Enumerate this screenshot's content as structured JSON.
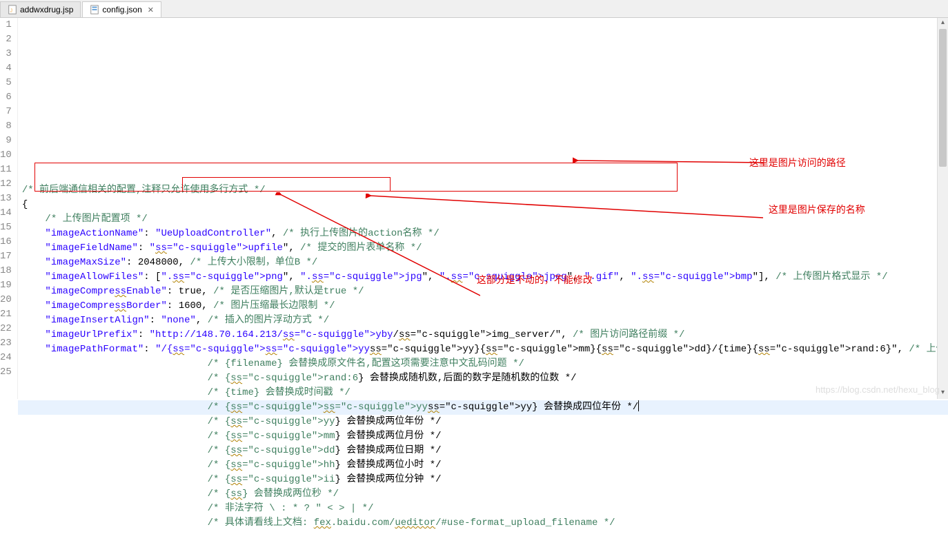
{
  "tabs": [
    {
      "label": "addwxdrug.jsp",
      "icon": "jsp-file-icon",
      "active": false
    },
    {
      "label": "config.json",
      "icon": "json-file-icon",
      "active": true
    }
  ],
  "annotations": {
    "url_prefix_note": "这里是图片访问的路径",
    "path_format_note": "这里是图片保存的名称",
    "fixed_part_note": "这部分是不动的，不能修改"
  },
  "watermark": "https://blog.csdn.net/hexu_blog",
  "code_lines": [
    {
      "n": 1,
      "tokens": [
        [
          "comment",
          "/* 前后端通信相关的配置,注释只允许使用多行方式 */"
        ]
      ]
    },
    {
      "n": 2,
      "tokens": [
        [
          "punc",
          "{"
        ]
      ]
    },
    {
      "n": 3,
      "indent": 2,
      "tokens": [
        [
          "comment",
          "/* 上传图片配置项 */"
        ]
      ]
    },
    {
      "n": 4,
      "indent": 2,
      "tokens": [
        [
          "key",
          "\"imageActionName\""
        ],
        [
          "punc",
          ": "
        ],
        [
          "str",
          "\"UeUploadController\""
        ],
        [
          "punc",
          ", "
        ],
        [
          "comment",
          "/* 执行上传图片的action名称 */"
        ]
      ]
    },
    {
      "n": 5,
      "indent": 2,
      "tokens": [
        [
          "key",
          "\"imageFieldName\""
        ],
        [
          "punc",
          ": "
        ],
        [
          "str",
          "\"upfile\""
        ],
        [
          "punc",
          ", "
        ],
        [
          "comment",
          "/* 提交的图片表单名称 */"
        ]
      ]
    },
    {
      "n": 6,
      "indent": 2,
      "tokens": [
        [
          "key",
          "\"imageMaxSize\""
        ],
        [
          "punc",
          ": "
        ],
        [
          "num",
          "2048000"
        ],
        [
          "punc",
          ", "
        ],
        [
          "comment",
          "/* 上传大小限制，单位B */"
        ]
      ]
    },
    {
      "n": 7,
      "indent": 2,
      "tokens": [
        [
          "key",
          "\"imageAllowFiles\""
        ],
        [
          "punc",
          ": ["
        ],
        [
          "str",
          "\".png\""
        ],
        [
          "punc",
          ", "
        ],
        [
          "str",
          "\".jpg\""
        ],
        [
          "punc",
          ", "
        ],
        [
          "str",
          "\".jpeg\""
        ],
        [
          "punc",
          ", "
        ],
        [
          "str",
          "\".gif\""
        ],
        [
          "punc",
          ", "
        ],
        [
          "str",
          "\".bmp\""
        ],
        [
          "punc",
          "], "
        ],
        [
          "comment",
          "/* 上传图片格式显示 */"
        ]
      ]
    },
    {
      "n": 8,
      "indent": 2,
      "tokens": [
        [
          "key",
          "\"imageCompressEnable\""
        ],
        [
          "punc",
          ": "
        ],
        [
          "num",
          "true"
        ],
        [
          "punc",
          ", "
        ],
        [
          "comment",
          "/* 是否压缩图片,默认是true */"
        ]
      ]
    },
    {
      "n": 9,
      "indent": 2,
      "tokens": [
        [
          "key",
          "\"imageCompressBorder\""
        ],
        [
          "punc",
          ": "
        ],
        [
          "num",
          "1600"
        ],
        [
          "punc",
          ", "
        ],
        [
          "comment",
          "/* 图片压缩最长边限制 */"
        ]
      ]
    },
    {
      "n": 10,
      "indent": 2,
      "tokens": [
        [
          "key",
          "\"imageInsertAlign\""
        ],
        [
          "punc",
          ": "
        ],
        [
          "str",
          "\"none\""
        ],
        [
          "punc",
          ", "
        ],
        [
          "comment",
          "/* 插入的图片浮动方式 */"
        ]
      ]
    },
    {
      "n": 11,
      "indent": 2,
      "tokens": [
        [
          "key",
          "\"imageUrlPrefix\""
        ],
        [
          "punc",
          ": "
        ],
        [
          "str",
          "\"http://148.70.164.213/yby/img_server/\""
        ],
        [
          "punc",
          ", "
        ],
        [
          "comment",
          "/* 图片访问路径前缀 */"
        ]
      ]
    },
    {
      "n": 12,
      "indent": 2,
      "tokens": [
        [
          "key",
          "\"imagePathFormat\""
        ],
        [
          "punc",
          ": "
        ],
        [
          "str",
          "\"/{yyyy}{mm}{dd}/{time}{rand:6}\""
        ],
        [
          "punc",
          ", "
        ],
        [
          "comment",
          "/* 上传保存路径,可以自定义保存路径和文件名格式 */"
        ]
      ]
    },
    {
      "n": 13,
      "indent": 16,
      "tokens": [
        [
          "comment",
          "/* {filename} 会替换成原文件名,配置这项需要注意中文乱码问题 */"
        ]
      ]
    },
    {
      "n": 14,
      "indent": 16,
      "tokens": [
        [
          "comment",
          "/* {rand:6} 会替换成随机数,后面的数字是随机数的位数 */"
        ]
      ]
    },
    {
      "n": 15,
      "indent": 16,
      "tokens": [
        [
          "comment",
          "/* {time} 会替换成时间戳 */"
        ]
      ]
    },
    {
      "n": 16,
      "indent": 16,
      "highlight": true,
      "cursor": true,
      "tokens": [
        [
          "comment",
          "/* {yyyy} 会替换成四位年份 */"
        ]
      ]
    },
    {
      "n": 17,
      "indent": 16,
      "tokens": [
        [
          "comment",
          "/* {yy} 会替换成两位年份 */"
        ]
      ]
    },
    {
      "n": 18,
      "indent": 16,
      "tokens": [
        [
          "comment",
          "/* {mm} 会替换成两位月份 */"
        ]
      ]
    },
    {
      "n": 19,
      "indent": 16,
      "tokens": [
        [
          "comment",
          "/* {dd} 会替换成两位日期 */"
        ]
      ]
    },
    {
      "n": 20,
      "indent": 16,
      "tokens": [
        [
          "comment",
          "/* {hh} 会替换成两位小时 */"
        ]
      ]
    },
    {
      "n": 21,
      "indent": 16,
      "tokens": [
        [
          "comment",
          "/* {ii} 会替换成两位分钟 */"
        ]
      ]
    },
    {
      "n": 22,
      "indent": 16,
      "tokens": [
        [
          "comment",
          "/* {ss} 会替换成两位秒 */"
        ]
      ]
    },
    {
      "n": 23,
      "indent": 16,
      "tokens": [
        [
          "comment",
          "/* 非法字符 \\ : * ? \" < > | */"
        ]
      ]
    },
    {
      "n": 24,
      "indent": 16,
      "tokens": [
        [
          "comment",
          "/* 具体请看线上文档: fex.baidu.com/ueditor/#use-format_upload_filename */"
        ]
      ]
    },
    {
      "n": 25,
      "tokens": []
    }
  ]
}
